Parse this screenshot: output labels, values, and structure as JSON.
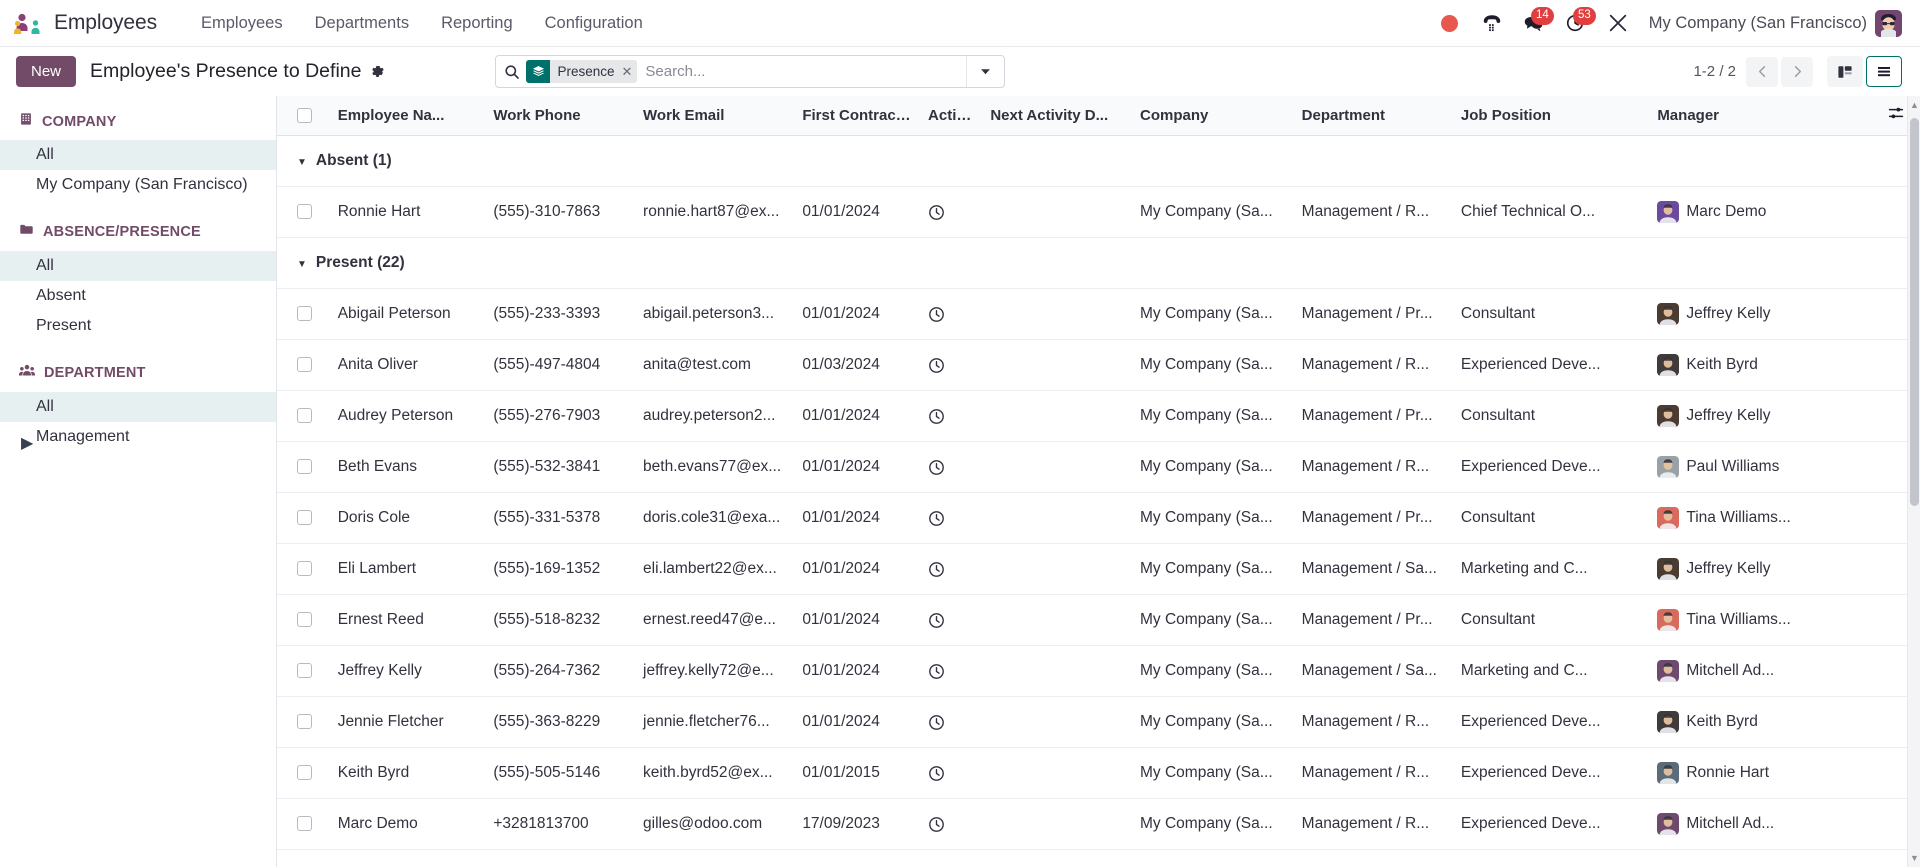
{
  "navbar": {
    "app_icon": "employees-app-icon",
    "brand": "Employees",
    "menu": [
      {
        "label": "Employees",
        "name": "menu-employees"
      },
      {
        "label": "Departments",
        "name": "menu-departments"
      },
      {
        "label": "Reporting",
        "name": "menu-reporting"
      },
      {
        "label": "Configuration",
        "name": "menu-configuration"
      }
    ],
    "systray": {
      "record_icon": "record-dot-icon",
      "voip_icon": "phone-dialpad-icon",
      "messages_icon": "messages-icon",
      "messages_count": "14",
      "activities_icon": "clock-activities-icon",
      "activities_count": "53",
      "debug_icon": "tools-debug-icon",
      "company": "My Company (San Francisco)",
      "avatar": "user-avatar"
    }
  },
  "control_panel": {
    "new_label": "New",
    "breadcrumb_title": "Employee's Presence to Define",
    "gear_icon": "gear-icon",
    "search": {
      "search_icon": "search-icon",
      "facet_icon": "layers-icon",
      "facet_label": "Presence",
      "facet_remove_icon": "close-icon",
      "placeholder": "Search...",
      "dropdown_icon": "chevron-down-icon"
    },
    "pager": {
      "count": "1-2 / 2",
      "prev_icon": "chevron-left-icon",
      "next_icon": "chevron-right-icon"
    },
    "views": [
      {
        "name": "kanban-view-button",
        "icon": "kanban-icon",
        "active": false
      },
      {
        "name": "list-view-button",
        "icon": "list-icon",
        "active": true
      }
    ]
  },
  "search_panel": {
    "sections": [
      {
        "title": "COMPANY",
        "icon": "building-icon",
        "name": "company",
        "items": [
          {
            "label": "All",
            "selected": true,
            "expandable": false
          },
          {
            "label": "My Company (San Francisco)",
            "selected": false,
            "expandable": false
          }
        ]
      },
      {
        "title": "ABSENCE/PRESENCE",
        "icon": "folder-icon",
        "name": "absence-presence",
        "items": [
          {
            "label": "All",
            "selected": true,
            "expandable": false
          },
          {
            "label": "Absent",
            "selected": false,
            "expandable": false
          },
          {
            "label": "Present",
            "selected": false,
            "expandable": false
          }
        ]
      },
      {
        "title": "DEPARTMENT",
        "icon": "people-icon",
        "name": "department",
        "items": [
          {
            "label": "All",
            "selected": true,
            "expandable": false
          },
          {
            "label": "Management",
            "selected": false,
            "expandable": true
          }
        ]
      }
    ]
  },
  "list": {
    "columns": [
      "Employee Na...",
      "Work Phone",
      "Work Email",
      "First Contract ...",
      "Activiti...",
      "Next Activity D...",
      "Company",
      "Department",
      "Job Position",
      "Manager"
    ],
    "optional_columns_icon": "column-settings-icon",
    "select_all_checkbox": "select-all-checkbox",
    "activity_icon": "clock-icon",
    "groups": [
      {
        "label": "Absent (1)",
        "caret": "▼",
        "rows": [
          {
            "name": "Ronnie Hart",
            "phone": "(555)-310-7863",
            "email": "ronnie.hart87@ex...",
            "contract_date": "01/01/2024",
            "next_activity": "",
            "company": "My Company (Sa...",
            "department": "Management / R...",
            "job_position": "Chief Technical O...",
            "manager": "Marc Demo",
            "manager_avatar_color": "#6b4b9e"
          }
        ]
      },
      {
        "label": "Present (22)",
        "caret": "▼",
        "rows": [
          {
            "name": "Abigail Peterson",
            "phone": "(555)-233-3393",
            "email": "abigail.peterson3...",
            "contract_date": "01/01/2024",
            "next_activity": "",
            "company": "My Company (Sa...",
            "department": "Management / Pr...",
            "job_position": "Consultant",
            "manager": "Jeffrey Kelly",
            "manager_avatar_color": "#4a3b33"
          },
          {
            "name": "Anita Oliver",
            "phone": "(555)-497-4804",
            "email": "anita@test.com",
            "contract_date": "01/03/2024",
            "next_activity": "",
            "company": "My Company (Sa...",
            "department": "Management / R...",
            "job_position": "Experienced Deve...",
            "manager": "Keith Byrd",
            "manager_avatar_color": "#3f3b3a"
          },
          {
            "name": "Audrey Peterson",
            "phone": "(555)-276-7903",
            "email": "audrey.peterson2...",
            "contract_date": "01/01/2024",
            "next_activity": "",
            "company": "My Company (Sa...",
            "department": "Management / Pr...",
            "job_position": "Consultant",
            "manager": "Jeffrey Kelly",
            "manager_avatar_color": "#4a3b33"
          },
          {
            "name": "Beth Evans",
            "phone": "(555)-532-3841",
            "email": "beth.evans77@ex...",
            "contract_date": "01/01/2024",
            "next_activity": "",
            "company": "My Company (Sa...",
            "department": "Management / R...",
            "job_position": "Experienced Deve...",
            "manager": "Paul Williams",
            "manager_avatar_color": "#9aa2a8"
          },
          {
            "name": "Doris Cole",
            "phone": "(555)-331-5378",
            "email": "doris.cole31@exa...",
            "contract_date": "01/01/2024",
            "next_activity": "",
            "company": "My Company (Sa...",
            "department": "Management / Pr...",
            "job_position": "Consultant",
            "manager": "Tina Williams...",
            "manager_avatar_color": "#d96a5e"
          },
          {
            "name": "Eli Lambert",
            "phone": "(555)-169-1352",
            "email": "eli.lambert22@ex...",
            "contract_date": "01/01/2024",
            "next_activity": "",
            "company": "My Company (Sa...",
            "department": "Management / Sa...",
            "job_position": "Marketing and C...",
            "manager": "Jeffrey Kelly",
            "manager_avatar_color": "#4a3b33"
          },
          {
            "name": "Ernest Reed",
            "phone": "(555)-518-8232",
            "email": "ernest.reed47@e...",
            "contract_date": "01/01/2024",
            "next_activity": "",
            "company": "My Company (Sa...",
            "department": "Management / Pr...",
            "job_position": "Consultant",
            "manager": "Tina Williams...",
            "manager_avatar_color": "#d96a5e"
          },
          {
            "name": "Jeffrey Kelly",
            "phone": "(555)-264-7362",
            "email": "jeffrey.kelly72@e...",
            "contract_date": "01/01/2024",
            "next_activity": "",
            "company": "My Company (Sa...",
            "department": "Management / Sa...",
            "job_position": "Marketing and C...",
            "manager": "Mitchell Ad...",
            "manager_avatar_color": "#6e4b6e"
          },
          {
            "name": "Jennie Fletcher",
            "phone": "(555)-363-8229",
            "email": "jennie.fletcher76...",
            "contract_date": "01/01/2024",
            "next_activity": "",
            "company": "My Company (Sa...",
            "department": "Management / R...",
            "job_position": "Experienced Deve...",
            "manager": "Keith Byrd",
            "manager_avatar_color": "#3f3b3a"
          },
          {
            "name": "Keith Byrd",
            "phone": "(555)-505-5146",
            "email": "keith.byrd52@ex...",
            "contract_date": "01/01/2015",
            "next_activity": "",
            "company": "My Company (Sa...",
            "department": "Management / R...",
            "job_position": "Experienced Deve...",
            "manager": "Ronnie Hart",
            "manager_avatar_color": "#5a6b7a"
          },
          {
            "name": "Marc Demo",
            "phone": "+3281813700",
            "email": "gilles@odoo.com",
            "contract_date": "17/09/2023",
            "next_activity": "",
            "company": "My Company (Sa...",
            "department": "Management / R...",
            "job_position": "Experienced Deve...",
            "manager": "Mitchell Ad...",
            "manager_avatar_color": "#6e4b6e"
          }
        ]
      }
    ]
  },
  "colors": {
    "primary": "#714b67",
    "accent": "#00706b",
    "badge_red": "#e03f3f",
    "selected_bg": "#e6f0f0"
  }
}
